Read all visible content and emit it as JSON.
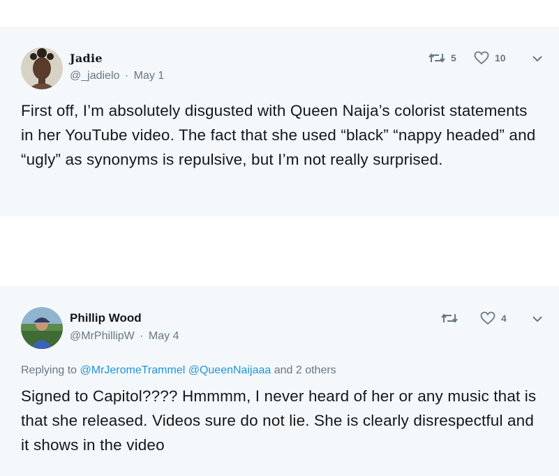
{
  "tweets": [
    {
      "display_name": "Jadie",
      "handle": "@_jadielo",
      "separator": "·",
      "date": "May 1",
      "retweets": "5",
      "likes": "10",
      "text": "First off, I’m absolutely disgusted with Queen Naija’s colorist statements in her YouTube video. The fact that she used “black” “nappy headed” and “ugly” as synonyms is repulsive, but I’m not really surprised."
    },
    {
      "display_name": "Phillip Wood",
      "handle": "@MrPhillipW",
      "separator": "·",
      "date": "May 4",
      "retweets": "",
      "likes": "4",
      "replying_prefix": "Replying to",
      "replying_mention_1": "@MrJeromeTrammel",
      "replying_mention_2": "@QueenNaijaaa",
      "replying_suffix": "and 2 others",
      "text": "Signed to Capitol???? Hmmmm, I never heard of her or any music that is that she released. Videos sure do not lie. She is clearly disrespectful and it shows in the video"
    }
  ],
  "colors": {
    "card_background": "#f5f8fa",
    "text_primary": "#14171a",
    "text_secondary": "#657786",
    "mention_blue": "#1b95e0"
  }
}
